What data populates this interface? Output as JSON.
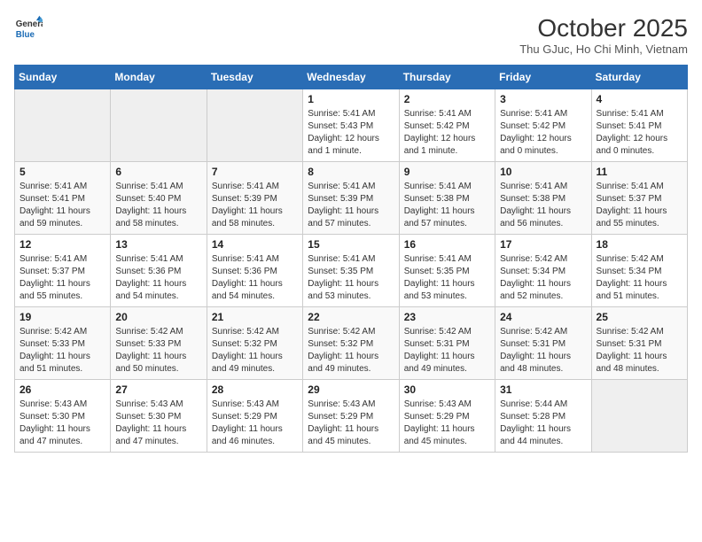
{
  "header": {
    "logo_line1": "General",
    "logo_line2": "Blue",
    "month": "October 2025",
    "location": "Thu GJuc, Ho Chi Minh, Vietnam"
  },
  "weekdays": [
    "Sunday",
    "Monday",
    "Tuesday",
    "Wednesday",
    "Thursday",
    "Friday",
    "Saturday"
  ],
  "weeks": [
    [
      {
        "day": "",
        "empty": true
      },
      {
        "day": "",
        "empty": true
      },
      {
        "day": "",
        "empty": true
      },
      {
        "day": "1",
        "sunrise": "5:41 AM",
        "sunset": "5:43 PM",
        "daylight": "12 hours and 1 minute."
      },
      {
        "day": "2",
        "sunrise": "5:41 AM",
        "sunset": "5:42 PM",
        "daylight": "12 hours and 1 minute."
      },
      {
        "day": "3",
        "sunrise": "5:41 AM",
        "sunset": "5:42 PM",
        "daylight": "12 hours and 0 minutes."
      },
      {
        "day": "4",
        "sunrise": "5:41 AM",
        "sunset": "5:41 PM",
        "daylight": "12 hours and 0 minutes."
      }
    ],
    [
      {
        "day": "5",
        "sunrise": "5:41 AM",
        "sunset": "5:41 PM",
        "daylight": "11 hours and 59 minutes."
      },
      {
        "day": "6",
        "sunrise": "5:41 AM",
        "sunset": "5:40 PM",
        "daylight": "11 hours and 58 minutes."
      },
      {
        "day": "7",
        "sunrise": "5:41 AM",
        "sunset": "5:39 PM",
        "daylight": "11 hours and 58 minutes."
      },
      {
        "day": "8",
        "sunrise": "5:41 AM",
        "sunset": "5:39 PM",
        "daylight": "11 hours and 57 minutes."
      },
      {
        "day": "9",
        "sunrise": "5:41 AM",
        "sunset": "5:38 PM",
        "daylight": "11 hours and 57 minutes."
      },
      {
        "day": "10",
        "sunrise": "5:41 AM",
        "sunset": "5:38 PM",
        "daylight": "11 hours and 56 minutes."
      },
      {
        "day": "11",
        "sunrise": "5:41 AM",
        "sunset": "5:37 PM",
        "daylight": "11 hours and 55 minutes."
      }
    ],
    [
      {
        "day": "12",
        "sunrise": "5:41 AM",
        "sunset": "5:37 PM",
        "daylight": "11 hours and 55 minutes."
      },
      {
        "day": "13",
        "sunrise": "5:41 AM",
        "sunset": "5:36 PM",
        "daylight": "11 hours and 54 minutes."
      },
      {
        "day": "14",
        "sunrise": "5:41 AM",
        "sunset": "5:36 PM",
        "daylight": "11 hours and 54 minutes."
      },
      {
        "day": "15",
        "sunrise": "5:41 AM",
        "sunset": "5:35 PM",
        "daylight": "11 hours and 53 minutes."
      },
      {
        "day": "16",
        "sunrise": "5:41 AM",
        "sunset": "5:35 PM",
        "daylight": "11 hours and 53 minutes."
      },
      {
        "day": "17",
        "sunrise": "5:42 AM",
        "sunset": "5:34 PM",
        "daylight": "11 hours and 52 minutes."
      },
      {
        "day": "18",
        "sunrise": "5:42 AM",
        "sunset": "5:34 PM",
        "daylight": "11 hours and 51 minutes."
      }
    ],
    [
      {
        "day": "19",
        "sunrise": "5:42 AM",
        "sunset": "5:33 PM",
        "daylight": "11 hours and 51 minutes."
      },
      {
        "day": "20",
        "sunrise": "5:42 AM",
        "sunset": "5:33 PM",
        "daylight": "11 hours and 50 minutes."
      },
      {
        "day": "21",
        "sunrise": "5:42 AM",
        "sunset": "5:32 PM",
        "daylight": "11 hours and 49 minutes."
      },
      {
        "day": "22",
        "sunrise": "5:42 AM",
        "sunset": "5:32 PM",
        "daylight": "11 hours and 49 minutes."
      },
      {
        "day": "23",
        "sunrise": "5:42 AM",
        "sunset": "5:31 PM",
        "daylight": "11 hours and 49 minutes."
      },
      {
        "day": "24",
        "sunrise": "5:42 AM",
        "sunset": "5:31 PM",
        "daylight": "11 hours and 48 minutes."
      },
      {
        "day": "25",
        "sunrise": "5:42 AM",
        "sunset": "5:31 PM",
        "daylight": "11 hours and 48 minutes."
      }
    ],
    [
      {
        "day": "26",
        "sunrise": "5:43 AM",
        "sunset": "5:30 PM",
        "daylight": "11 hours and 47 minutes."
      },
      {
        "day": "27",
        "sunrise": "5:43 AM",
        "sunset": "5:30 PM",
        "daylight": "11 hours and 47 minutes."
      },
      {
        "day": "28",
        "sunrise": "5:43 AM",
        "sunset": "5:29 PM",
        "daylight": "11 hours and 46 minutes."
      },
      {
        "day": "29",
        "sunrise": "5:43 AM",
        "sunset": "5:29 PM",
        "daylight": "11 hours and 45 minutes."
      },
      {
        "day": "30",
        "sunrise": "5:43 AM",
        "sunset": "5:29 PM",
        "daylight": "11 hours and 45 minutes."
      },
      {
        "day": "31",
        "sunrise": "5:44 AM",
        "sunset": "5:28 PM",
        "daylight": "11 hours and 44 minutes."
      },
      {
        "day": "",
        "empty": true
      }
    ]
  ],
  "labels": {
    "sunrise": "Sunrise:",
    "sunset": "Sunset:",
    "daylight": "Daylight:"
  }
}
